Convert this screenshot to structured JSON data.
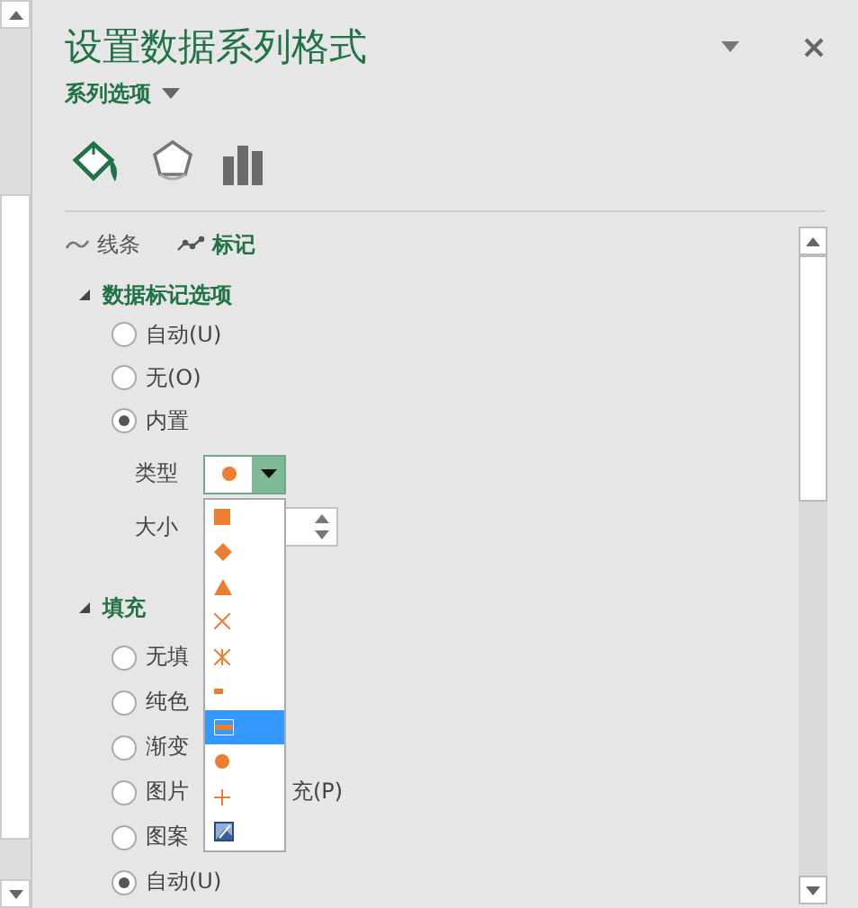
{
  "title": "设置数据系列格式",
  "series_menu": {
    "label": "系列选项"
  },
  "icon_tabs": [
    {
      "kind": "fill",
      "selected": true
    },
    {
      "kind": "effects",
      "selected": false
    },
    {
      "kind": "series",
      "selected": false
    }
  ],
  "sub_tabs": [
    {
      "kind": "line",
      "label": "线条",
      "selected": false
    },
    {
      "kind": "marker",
      "label": "标记",
      "selected": true
    }
  ],
  "marker_section": {
    "title": "数据标记选项",
    "expanded": true,
    "options": [
      {
        "label": "自动(U)",
        "selected": false
      },
      {
        "label": "无(O)",
        "selected": false
      },
      {
        "label": "内置",
        "selected": true
      }
    ],
    "type_label": "类型",
    "type_field": {
      "kind": "circle"
    },
    "size_label": "大小"
  },
  "marker_list": [
    {
      "kind": "square",
      "selected": false
    },
    {
      "kind": "diamond",
      "selected": false
    },
    {
      "kind": "triangle",
      "selected": false
    },
    {
      "kind": "x",
      "selected": false
    },
    {
      "kind": "star",
      "selected": false
    },
    {
      "kind": "dash",
      "selected": false
    },
    {
      "kind": "long-dash",
      "selected": true
    },
    {
      "kind": "circle",
      "selected": false
    },
    {
      "kind": "plus",
      "selected": false
    },
    {
      "kind": "picture",
      "selected": false
    }
  ],
  "fill_section": {
    "title": "填充",
    "expanded": true,
    "options": [
      {
        "label": "无填",
        "selected": false
      },
      {
        "label": "纯色",
        "selected": false
      },
      {
        "label": "渐变",
        "selected": false
      },
      {
        "label": "图片",
        "trailing": "充(P)",
        "selected": false
      },
      {
        "label": "图案",
        "selected": false
      },
      {
        "label": "自动(U)",
        "selected": true
      }
    ]
  }
}
